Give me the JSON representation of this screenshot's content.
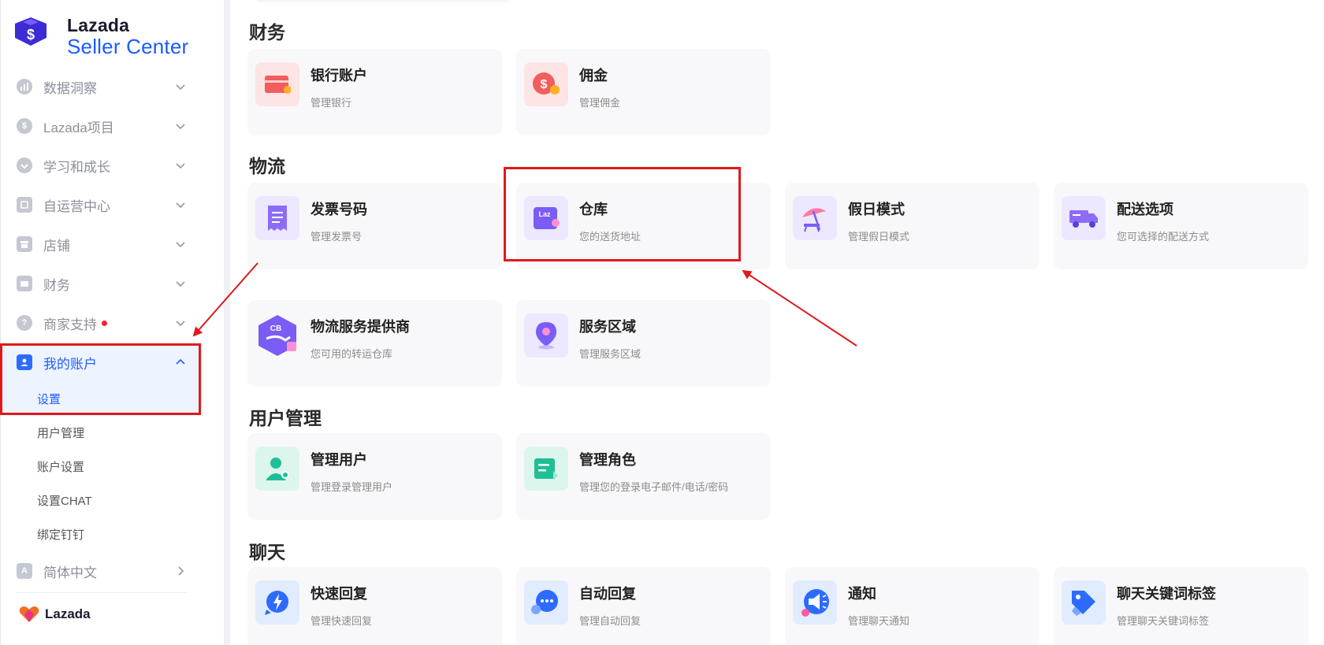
{
  "brand": {
    "line1": "Lazada",
    "line2": "Seller Center",
    "footer": "Lazada"
  },
  "sidebar": {
    "items": [
      {
        "label": "数据洞察",
        "icon": "chart-icon"
      },
      {
        "label": "Lazada项目",
        "icon": "dollar-icon"
      },
      {
        "label": "学习和成长",
        "icon": "growth-icon"
      },
      {
        "label": "自运营中心",
        "icon": "self-ops-icon"
      },
      {
        "label": "店铺",
        "icon": "store-icon"
      },
      {
        "label": "财务",
        "icon": "wallet-icon"
      },
      {
        "label": "商家支持",
        "icon": "help-icon"
      },
      {
        "label": "我的账户",
        "icon": "account-icon"
      }
    ],
    "sub_items": [
      "设置",
      "用户管理",
      "账户设置",
      "设置CHAT",
      "绑定钉钉"
    ],
    "language": "简体中文"
  },
  "sections": {
    "finance": {
      "title": "财务",
      "cards": [
        {
          "title": "银行账户",
          "desc": "管理银行"
        },
        {
          "title": "佣金",
          "desc": "管理佣金"
        }
      ]
    },
    "logistics": {
      "title": "物流",
      "cards": [
        {
          "title": "发票号码",
          "desc": "管理发票号"
        },
        {
          "title": "仓库",
          "desc": "您的送货地址",
          "icon_text": "Laz"
        },
        {
          "title": "假日模式",
          "desc": "管理假日模式"
        },
        {
          "title": "配送选项",
          "desc": "您可选择的配送方式"
        },
        {
          "title": "物流服务提供商",
          "desc": "您可用的转运仓库",
          "icon_text": "CB"
        },
        {
          "title": "服务区域",
          "desc": "管理服务区域"
        }
      ]
    },
    "users": {
      "title": "用户管理",
      "cards": [
        {
          "title": "管理用户",
          "desc": "管理登录管理用户"
        },
        {
          "title": "管理角色",
          "desc": "管理您的登录电子邮件/电话/密码"
        }
      ]
    },
    "chat": {
      "title": "聊天",
      "cards": [
        {
          "title": "快速回复",
          "desc": "管理快速回复"
        },
        {
          "title": "自动回复",
          "desc": "管理自动回复"
        },
        {
          "title": "通知",
          "desc": "管理聊天通知"
        },
        {
          "title": "聊天关键词标签",
          "desc": "管理聊天关键词标签"
        }
      ]
    }
  },
  "colors": {
    "accent": "#1f5cff",
    "annotation": "#e0191c",
    "finance_icon": "#f25d5d",
    "logistics_icon": "#7b5cf5",
    "users_icon": "#1fbf95",
    "chat_icon": "#2d6bff"
  }
}
